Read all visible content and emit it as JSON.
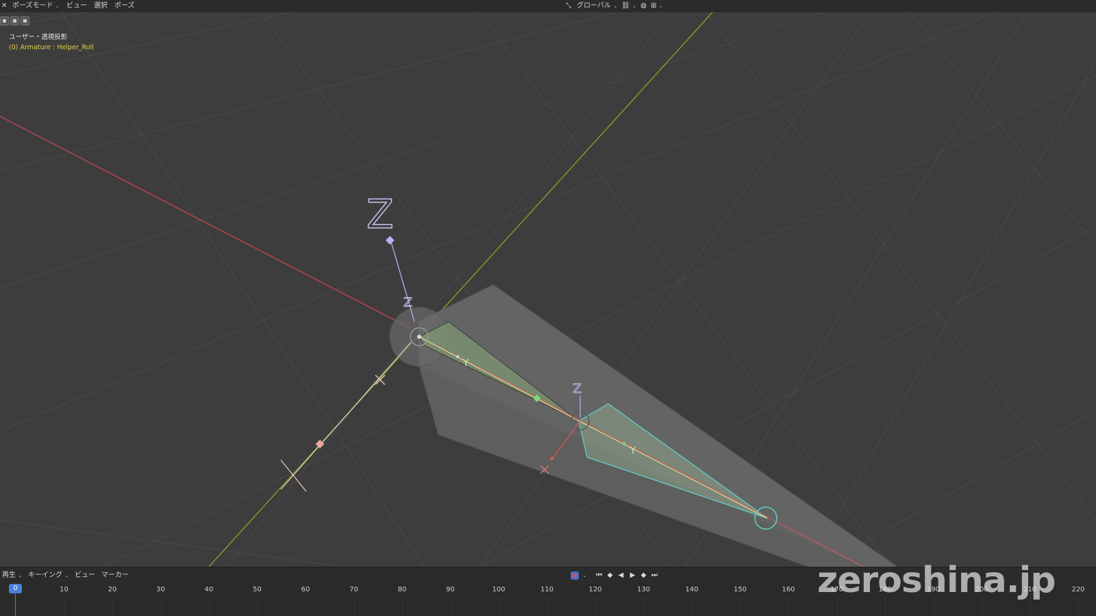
{
  "header": {
    "mode": "ポーズモード",
    "menus": [
      "ビュー",
      "選択",
      "ポーズ"
    ],
    "transform_orientation": "グローバル"
  },
  "viewport": {
    "view_label": "ユーザー・透視投影",
    "object_label": "(0) Armature : Helper_Roll",
    "axis_labels": {
      "z_large": "Z",
      "z_small": "Z",
      "y1": "Y",
      "y2": "Y",
      "z2": "Z",
      "x1": "X",
      "x2": "X"
    }
  },
  "timeline": {
    "menus": [
      "再生",
      "キーイング",
      "ビュー",
      "マーカー"
    ],
    "current_frame": "0",
    "frame_ticks": [
      "10",
      "20",
      "30",
      "40",
      "50",
      "60",
      "70",
      "80",
      "90",
      "100",
      "110",
      "120",
      "130",
      "140",
      "150",
      "160",
      "170",
      "180",
      "190",
      "200",
      "210",
      "220"
    ]
  },
  "watermark": "zeroshina.jp",
  "colors": {
    "background": "#3d3d3d",
    "header": "#2b2b2b",
    "x_axis": "#c9434f",
    "y_axis": "#7aa52a",
    "bone_select": "#5fd1c8",
    "object_label": "#e2d34a"
  },
  "icons": [
    "pose-mode-icon",
    "transform-orientation-icon",
    "pivot-icon",
    "snap-icon",
    "record-icon",
    "jump-start-icon",
    "prev-keyframe-icon",
    "play-reverse-icon",
    "play-icon",
    "next-keyframe-icon",
    "jump-end-icon"
  ]
}
